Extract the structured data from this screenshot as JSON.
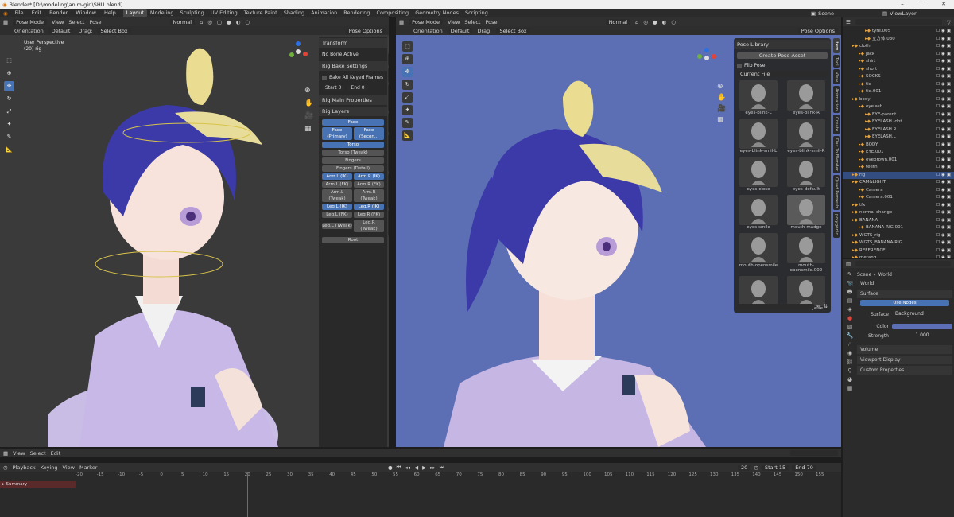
{
  "window": {
    "title": "Blender* [D:\\modeling\\anim-girl\\SHU.blend]"
  },
  "menu": {
    "file": "File",
    "edit": "Edit",
    "render": "Render",
    "window": "Window",
    "help": "Help"
  },
  "workspaces": [
    "Layout",
    "Modeling",
    "Sculpting",
    "UV Editing",
    "Texture Paint",
    "Shading",
    "Animation",
    "Rendering",
    "Compositing",
    "Geometry Nodes",
    "Scripting"
  ],
  "scene": {
    "label": "Scene",
    "viewlayer": "ViewLayer"
  },
  "vp_left": {
    "mode": "Pose Mode",
    "view": "View",
    "select": "Select",
    "pose": "Pose",
    "shading": "Normal",
    "orientation_label": "Orientation",
    "orientation": "Default",
    "drag_label": "Drag:",
    "drag": "Select Box",
    "pose_options": "Pose Options",
    "info1": "User Perspective",
    "info2": "(20) rig"
  },
  "npanel": {
    "transform": "Transform",
    "no_bone": "No Bone Active",
    "rig_bake": "Rig Bake Settings",
    "bake_all": "Bake All Keyed Frames",
    "start": "Start",
    "start_val": "0",
    "end": "End",
    "end_val": "0",
    "rig_main": "Rig Main Properties",
    "rig_layers": "Rig Layers",
    "layers": {
      "face": "Face",
      "face_primary": "Face (Primary)",
      "face_secondary": "Face (Secon...",
      "torso": "Torso",
      "torso_tweak": "Torso (Tweak)",
      "fingers": "Fingers",
      "fingers_detail": "Fingers (Detail)",
      "arm_l_ik": "Arm.L (IK)",
      "arm_r_ik": "Arm.R (IK)",
      "arm_l_fk": "Arm.L (FK)",
      "arm_r_fk": "Arm.R (FK)",
      "arm_l_tw": "Arm.L (Tweak)",
      "arm_r_tw": "Arm.R (Tweak)",
      "leg_l_ik": "Leg.L (IK)",
      "leg_r_ik": "Leg.R (IK)",
      "leg_l_fk": "Leg.L (FK)",
      "leg_r_fk": "Leg.R (FK)",
      "leg_l_tw": "Leg.L (Tweak)",
      "leg_r_tw": "Leg.R (Tweak)",
      "root": "Root"
    },
    "tabs": [
      "Item",
      "Tool",
      "View",
      "Animation",
      "Create",
      "Daz To Blender",
      "Quad Remesh",
      "polygoniq"
    ]
  },
  "vp_right": {
    "mode": "Pose Mode",
    "view": "View",
    "select": "Select",
    "pose": "Pose",
    "shading": "Normal",
    "orientation_label": "Orientation",
    "orientation": "Default",
    "drag_label": "Drag:",
    "drag": "Select Box",
    "pose_options": "Pose Options"
  },
  "pose_library": {
    "title": "Pose Library",
    "create": "Create Pose Asset",
    "flip": "Flip Pose",
    "library": "Current File",
    "poses": [
      "eyes-blink-L",
      "eyes-blink-R",
      "eyes-blink-smil-L",
      "eyes-blink-smil-R",
      "eyes-close",
      "eyes-default",
      "eyes-smile",
      "mouth-madge",
      "mouth-opensmile",
      "mouth-opensmile.002",
      "mouth-smile",
      "mouth-surprise"
    ],
    "tabs": [
      "Item",
      "Tool",
      "View",
      "Animation",
      "Create",
      "Daz To Blender",
      "Quad Remesh",
      "polygoniq"
    ]
  },
  "outliner": {
    "rows": [
      {
        "name": "tyre.005",
        "indent": 3
      },
      {
        "name": "立方体.030",
        "indent": 3
      },
      {
        "name": "cloth",
        "indent": 1
      },
      {
        "name": "jack",
        "indent": 2
      },
      {
        "name": "shirt",
        "indent": 2
      },
      {
        "name": "short",
        "indent": 2
      },
      {
        "name": "SOCKS",
        "indent": 2
      },
      {
        "name": "tie",
        "indent": 2
      },
      {
        "name": "tie.001",
        "indent": 2
      },
      {
        "name": "body",
        "indent": 1
      },
      {
        "name": "eyelash",
        "indent": 2
      },
      {
        "name": "EYE-parent",
        "indent": 3
      },
      {
        "name": "EYELASH.-dot",
        "indent": 3
      },
      {
        "name": "EYELASH.R",
        "indent": 3
      },
      {
        "name": "EYELASH.L",
        "indent": 3
      },
      {
        "name": "BODY",
        "indent": 2
      },
      {
        "name": "EYE.001",
        "indent": 2
      },
      {
        "name": "eyebrown.001",
        "indent": 2
      },
      {
        "name": "teeth",
        "indent": 2
      },
      {
        "name": "rig",
        "indent": 1,
        "selected": true
      },
      {
        "name": "CAM&LIGHT",
        "indent": 1
      },
      {
        "name": "Camera",
        "indent": 2
      },
      {
        "name": "Camera.001",
        "indent": 2
      },
      {
        "name": "tfx",
        "indent": 1
      },
      {
        "name": "normal change",
        "indent": 1
      },
      {
        "name": "BANANA",
        "indent": 1
      },
      {
        "name": "BANANA-RIG.001",
        "indent": 2
      },
      {
        "name": "WGTS_rig",
        "indent": 1
      },
      {
        "name": "WGTS_BANANA-RIG",
        "indent": 1
      },
      {
        "name": "REFERENCE",
        "indent": 1
      },
      {
        "name": "metang",
        "indent": 1
      }
    ]
  },
  "properties": {
    "scene": "Scene",
    "world": "World",
    "world_name": "World",
    "surface": "Surface",
    "use_nodes": "Use Nodes",
    "surface_label": "Surface",
    "surface_val": "Background",
    "color_label": "Color",
    "strength_label": "Strength",
    "strength_val": "1.000",
    "volume": "Volume",
    "viewport_display": "Viewport Display",
    "custom_props": "Custom Properties",
    "world_color": "#5c6fb5"
  },
  "timeline_editor": {
    "view": "View",
    "select": "Select",
    "edit": "Edit"
  },
  "timeline": {
    "playback": "Playback",
    "keying": "Keying",
    "view": "View",
    "marker": "Marker",
    "current": "20",
    "start_label": "Start",
    "start": "15",
    "end_label": "End",
    "end": "70",
    "summary": "Summary",
    "ticks": [
      "-20",
      "-15",
      "-10",
      "-5",
      "0",
      "5",
      "10",
      "15",
      "20",
      "25",
      "30",
      "35",
      "40",
      "45",
      "50",
      "55",
      "60",
      "65",
      "70",
      "75",
      "80",
      "85",
      "90",
      "95",
      "100",
      "105",
      "110",
      "115",
      "120",
      "125",
      "130",
      "135",
      "140",
      "145",
      "150",
      "155"
    ]
  },
  "colors": {
    "accent": "#4772b3",
    "viewport_left": "#3a3a3a",
    "viewport_right": "#5c6fb5"
  }
}
